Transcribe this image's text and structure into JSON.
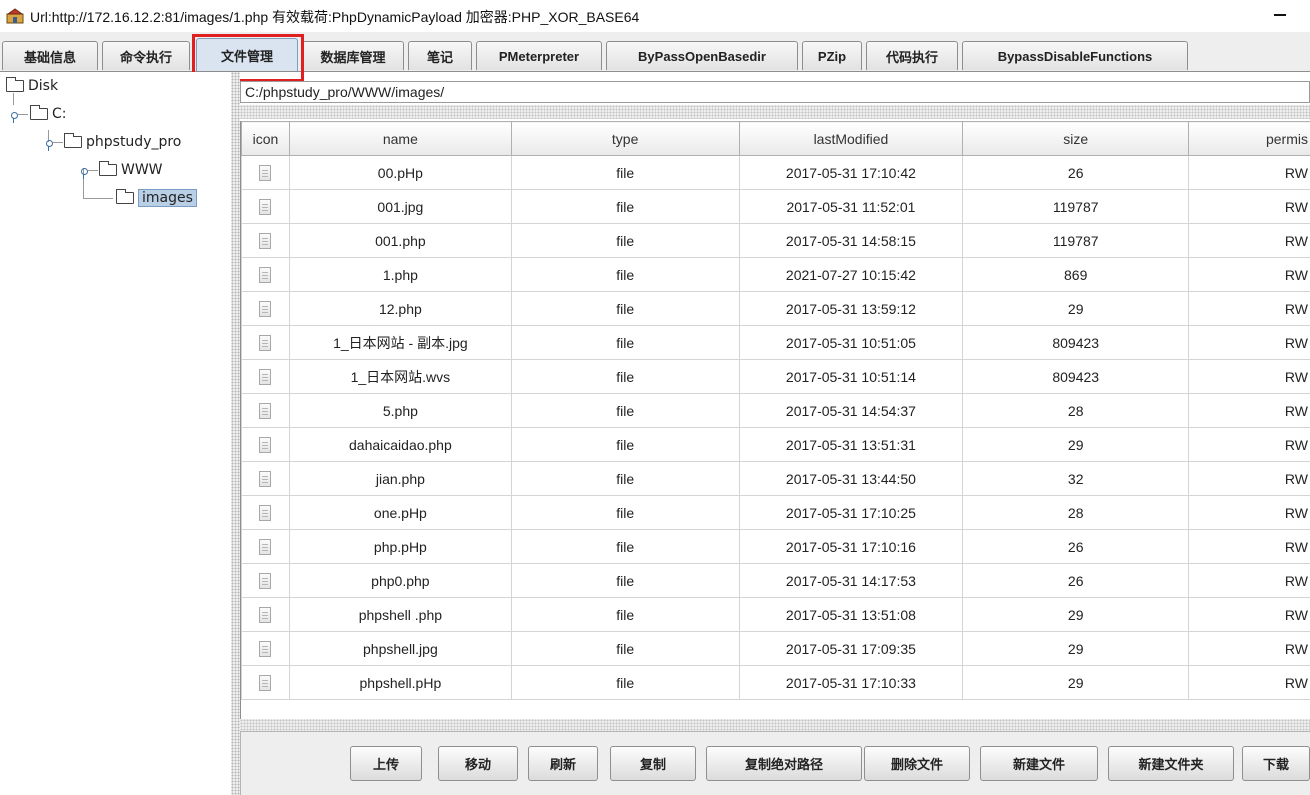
{
  "window": {
    "title": "Url:http://172.16.12.2:81/images/1.php 有效载荷:PhpDynamicPayload 加密器:PHP_XOR_BASE64",
    "app_icon": "shell-tool-icon",
    "minimize_icon": "minimize-icon"
  },
  "tabs": [
    {
      "label": "基础信息"
    },
    {
      "label": "命令执行"
    },
    {
      "label": "文件管理",
      "active": true
    },
    {
      "label": "数据库管理"
    },
    {
      "label": "笔记"
    },
    {
      "label": "PMeterpreter"
    },
    {
      "label": "ByPassOpenBasedir"
    },
    {
      "label": "PZip"
    },
    {
      "label": "代码执行"
    },
    {
      "label": "BypassDisableFunctions"
    }
  ],
  "highlight_color": "#e02020",
  "tree": {
    "root": "Disk",
    "drive": "C:",
    "dir1": "phpstudy_pro",
    "dir2": "WWW",
    "dir3": "images"
  },
  "path": "C:/phpstudy_pro/WWW/images/",
  "table": {
    "columns": [
      "icon",
      "name",
      "type",
      "lastModified",
      "size",
      "permis"
    ],
    "rows": [
      {
        "name": "00.pHp",
        "type": "file",
        "lastModified": "2017-05-31 17:10:42",
        "size": "26",
        "perm": "RW"
      },
      {
        "name": "001.jpg",
        "type": "file",
        "lastModified": "2017-05-31 11:52:01",
        "size": "119787",
        "perm": "RW"
      },
      {
        "name": "001.php",
        "type": "file",
        "lastModified": "2017-05-31 14:58:15",
        "size": "119787",
        "perm": "RW"
      },
      {
        "name": "1.php",
        "type": "file",
        "lastModified": "2021-07-27 10:15:42",
        "size": "869",
        "perm": "RW"
      },
      {
        "name": "12.php",
        "type": "file",
        "lastModified": "2017-05-31 13:59:12",
        "size": "29",
        "perm": "RW"
      },
      {
        "name": "1_日本网站 - 副本.jpg",
        "type": "file",
        "lastModified": "2017-05-31 10:51:05",
        "size": "809423",
        "perm": "RW"
      },
      {
        "name": "1_日本网站.wvs",
        "type": "file",
        "lastModified": "2017-05-31 10:51:14",
        "size": "809423",
        "perm": "RW"
      },
      {
        "name": "5.php",
        "type": "file",
        "lastModified": "2017-05-31 14:54:37",
        "size": "28",
        "perm": "RW"
      },
      {
        "name": "dahaicaidao.php",
        "type": "file",
        "lastModified": "2017-05-31 13:51:31",
        "size": "29",
        "perm": "RW"
      },
      {
        "name": "jian.php",
        "type": "file",
        "lastModified": "2017-05-31 13:44:50",
        "size": "32",
        "perm": "RW"
      },
      {
        "name": "one.pHp",
        "type": "file",
        "lastModified": "2017-05-31 17:10:25",
        "size": "28",
        "perm": "RW"
      },
      {
        "name": "php.pHp",
        "type": "file",
        "lastModified": "2017-05-31 17:10:16",
        "size": "26",
        "perm": "RW"
      },
      {
        "name": "php0.php",
        "type": "file",
        "lastModified": "2017-05-31 14:17:53",
        "size": "26",
        "perm": "RW"
      },
      {
        "name": "phpshell .php",
        "type": "file",
        "lastModified": "2017-05-31 13:51:08",
        "size": "29",
        "perm": "RW"
      },
      {
        "name": "phpshell.jpg",
        "type": "file",
        "lastModified": "2017-05-31 17:09:35",
        "size": "29",
        "perm": "RW"
      },
      {
        "name": "phpshell.pHp",
        "type": "file",
        "lastModified": "2017-05-31 17:10:33",
        "size": "29",
        "perm": "RW"
      }
    ]
  },
  "buttons": {
    "upload": "上传",
    "move": "移动",
    "refresh": "刷新",
    "copy": "复制",
    "copy_abs_path": "复制绝对路径",
    "delete_file": "删除文件",
    "new_file": "新建文件",
    "new_folder": "新建文件夹",
    "download": "下载"
  }
}
